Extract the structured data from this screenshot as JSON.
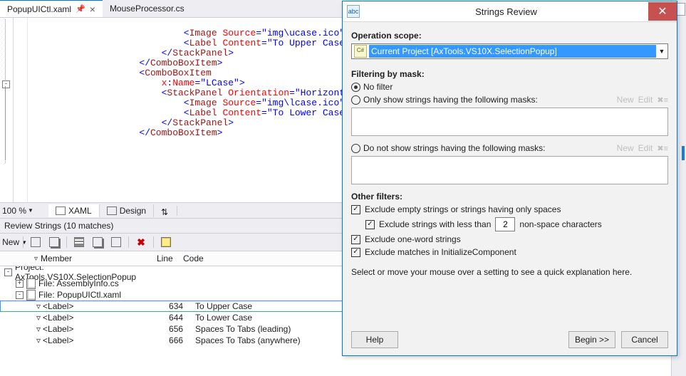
{
  "tabs": [
    {
      "label": "PopupUICtl.xaml",
      "active": true,
      "pinned": true
    },
    {
      "label": "MouseProcessor.cs",
      "active": false,
      "pinned": false
    }
  ],
  "code_lines": [
    {
      "ind": 28,
      "tokens": [
        [
          "delim",
          "<"
        ],
        [
          "tag",
          "Image"
        ],
        [
          "plain",
          " "
        ],
        [
          "attr",
          "Source"
        ],
        [
          "delim",
          "="
        ],
        [
          "str",
          "\"img\\ucase.ico\""
        ],
        [
          "plain",
          " "
        ]
      ]
    },
    {
      "ind": 28,
      "tokens": [
        [
          "delim",
          "<"
        ],
        [
          "tag",
          "Label"
        ],
        [
          "plain",
          " "
        ],
        [
          "attr",
          "Content"
        ],
        [
          "delim",
          "="
        ],
        [
          "str",
          "\"To Upper Case\""
        ],
        [
          "plain",
          " "
        ]
      ]
    },
    {
      "ind": 24,
      "tokens": [
        [
          "delim",
          "</"
        ],
        [
          "tag",
          "StackPanel"
        ],
        [
          "delim",
          ">"
        ]
      ]
    },
    {
      "ind": 0,
      "tokens": []
    },
    {
      "ind": 20,
      "tokens": [
        [
          "delim",
          "</"
        ],
        [
          "tag",
          "ComboBoxItem"
        ],
        [
          "delim",
          ">"
        ]
      ]
    },
    {
      "ind": 0,
      "tokens": []
    },
    {
      "ind": 20,
      "tokens": [
        [
          "delim",
          "<"
        ],
        [
          "tag",
          "ComboBoxItem"
        ]
      ]
    },
    {
      "ind": 24,
      "tokens": [
        [
          "attr",
          "x"
        ],
        [
          "delim",
          ":"
        ],
        [
          "attr",
          "Name"
        ],
        [
          "delim",
          "="
        ],
        [
          "str",
          "\"LCase\""
        ],
        [
          "delim",
          ">"
        ]
      ]
    },
    {
      "ind": 0,
      "tokens": []
    },
    {
      "ind": 24,
      "tokens": [
        [
          "delim",
          "<"
        ],
        [
          "tag",
          "StackPanel"
        ],
        [
          "plain",
          " "
        ],
        [
          "attr",
          "Orientation"
        ],
        [
          "delim",
          "="
        ],
        [
          "str",
          "\"Horizonta"
        ]
      ]
    },
    {
      "ind": 28,
      "tokens": [
        [
          "delim",
          "<"
        ],
        [
          "tag",
          "Image"
        ],
        [
          "plain",
          " "
        ],
        [
          "attr",
          "Source"
        ],
        [
          "delim",
          "="
        ],
        [
          "str",
          "\"img\\lcase.ico\""
        ],
        [
          "plain",
          " "
        ]
      ]
    },
    {
      "ind": 28,
      "tokens": [
        [
          "delim",
          "<"
        ],
        [
          "tag",
          "Label"
        ],
        [
          "plain",
          " "
        ],
        [
          "attr",
          "Content"
        ],
        [
          "delim",
          "="
        ],
        [
          "str",
          "\"To Lower Case\""
        ],
        [
          "plain",
          " "
        ]
      ]
    },
    {
      "ind": 24,
      "tokens": [
        [
          "delim",
          "</"
        ],
        [
          "tag",
          "StackPanel"
        ],
        [
          "delim",
          ">"
        ]
      ]
    },
    {
      "ind": 0,
      "tokens": []
    },
    {
      "ind": 20,
      "tokens": [
        [
          "delim",
          "</"
        ],
        [
          "tag",
          "ComboBoxItem"
        ],
        [
          "delim",
          ">"
        ]
      ]
    },
    {
      "ind": 0,
      "tokens": []
    }
  ],
  "zoom": "100 %",
  "view_buttons": {
    "xaml": "XAML",
    "design": "Design"
  },
  "tool_window": {
    "title": "Review Strings (10 matches)",
    "toolbar": {
      "new": "New",
      "drop": "▼"
    },
    "columns": {
      "member": "Member",
      "line": "Line",
      "code": "Code"
    },
    "rows": [
      {
        "depth": 0,
        "pm": "-",
        "icon": "none",
        "label": "Project: AxTools.VS10X.SelectionPopup",
        "line": "",
        "code": ""
      },
      {
        "depth": 1,
        "pm": "+",
        "icon": "file",
        "label": "File:  AssemblyInfo.cs",
        "line": "",
        "code": ""
      },
      {
        "depth": 1,
        "pm": "-",
        "icon": "file",
        "label": "File:  PopupUICtl.xaml",
        "line": "",
        "code": ""
      },
      {
        "depth": 2,
        "pm": "",
        "icon": "node",
        "label": "<Label>",
        "line": "634",
        "code": "To Upper Case",
        "selected": true
      },
      {
        "depth": 2,
        "pm": "",
        "icon": "node",
        "label": "<Label>",
        "line": "644",
        "code": "To Lower Case"
      },
      {
        "depth": 2,
        "pm": "",
        "icon": "node",
        "label": "<Label>",
        "line": "656",
        "code": "Spaces To Tabs (leading)"
      },
      {
        "depth": 2,
        "pm": "",
        "icon": "node",
        "label": "<Label>",
        "line": "666",
        "code": "Spaces To Tabs (anywhere)"
      }
    ]
  },
  "dialog": {
    "title": "Strings Review",
    "scope_label": "Operation scope:",
    "scope_value": "Current Project [AxTools.VS10X.SelectionPopup]",
    "scope_lang": "C#",
    "filter_heading": "Filtering by mask:",
    "filter_none": "No filter",
    "filter_only_label": "Only show strings having the following masks:",
    "filter_except_label": "Do not show strings having the following masks:",
    "link_new": "New",
    "link_edit": "Edit",
    "other_heading": "Other filters:",
    "cb_empty": "Exclude empty strings or strings having only spaces",
    "cb_minchars_pre": "Exclude strings with less than",
    "cb_minchars_val": "2",
    "cb_minchars_suf": "non-space characters",
    "cb_oneword": "Exclude one-word strings",
    "cb_initcomp": "Exclude matches in InitializeComponent",
    "hint": "Select or move your mouse over a setting to see a quick explanation here.",
    "btn_help": "Help",
    "btn_begin": "Begin >>",
    "btn_cancel": "Cancel"
  }
}
